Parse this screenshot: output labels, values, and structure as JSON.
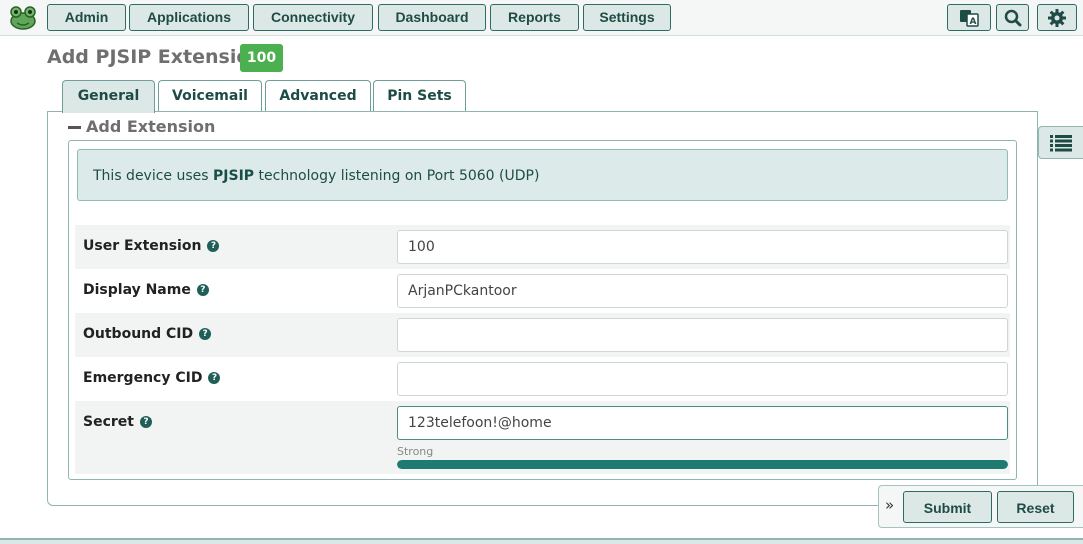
{
  "navbar": {
    "items": [
      {
        "label": "Admin"
      },
      {
        "label": "Applications"
      },
      {
        "label": "Connectivity"
      },
      {
        "label": "Dashboard"
      },
      {
        "label": "Reports"
      },
      {
        "label": "Settings"
      }
    ],
    "icons": [
      "language-icon",
      "search-icon",
      "gear-icon"
    ]
  },
  "page": {
    "title": "Add PJSIP Extension",
    "badge": "100"
  },
  "tabs": [
    {
      "label": "General",
      "active": true
    },
    {
      "label": "Voicemail"
    },
    {
      "label": "Advanced"
    },
    {
      "label": "Pin Sets"
    }
  ],
  "section": {
    "heading": "Add Extension"
  },
  "info": {
    "prefix": "This device uses ",
    "tech": "PJSIP",
    "suffix": " technology listening on Port 5060 (UDP)"
  },
  "fields": [
    {
      "label": "User Extension",
      "value": "100"
    },
    {
      "label": "Display Name",
      "value": "ArjanPCkantoor"
    },
    {
      "label": "Outbound CID",
      "value": ""
    },
    {
      "label": "Emergency CID",
      "value": ""
    },
    {
      "label": "Secret",
      "value": "123telefoon!@home"
    }
  ],
  "password_strength": {
    "label": "Strong",
    "fraction": 1.0
  },
  "actions": {
    "submit": "Submit",
    "reset": "Reset"
  },
  "colors": {
    "accent": "#1f7a72",
    "badge": "#4caf50",
    "button_bg": "#dce8e6"
  }
}
